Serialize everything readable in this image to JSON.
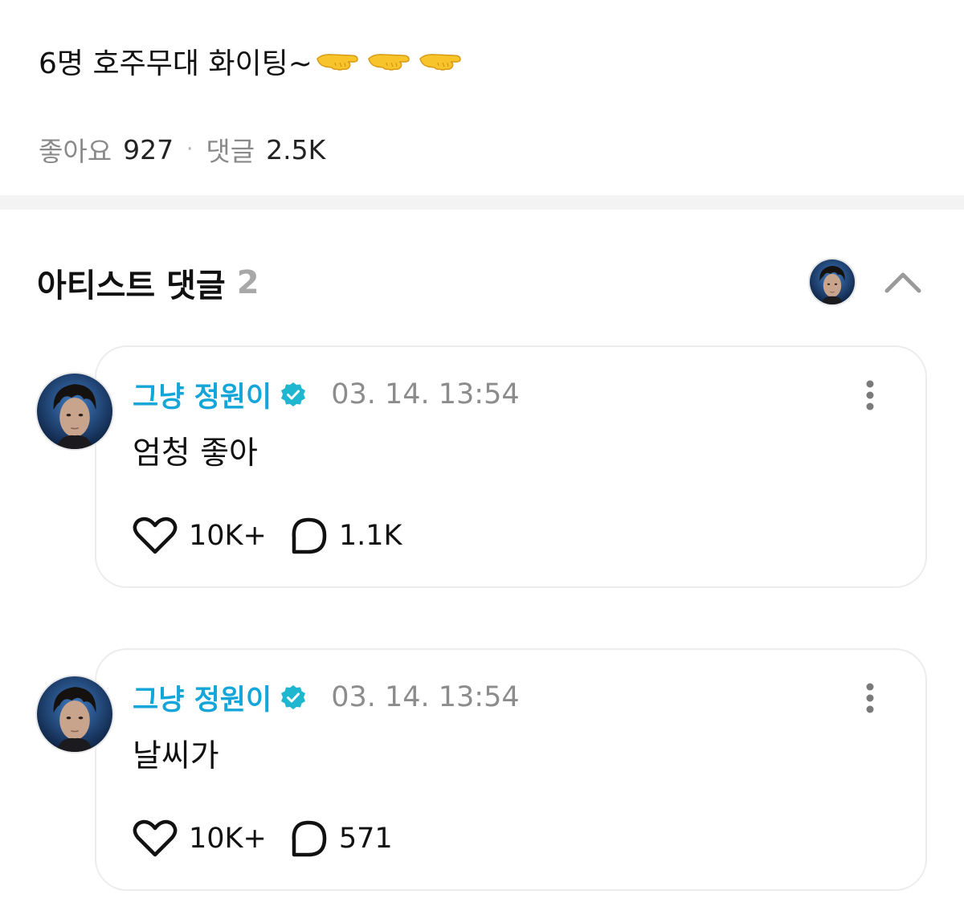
{
  "post": {
    "text": "6명 호주무대 화이팅~",
    "emoji_icons": [
      "backhand-index-pointing-left-emoji",
      "backhand-index-pointing-left-emoji",
      "backhand-index-pointing-left-emoji"
    ],
    "likes_label": "좋아요",
    "likes_value": "927",
    "separator": "·",
    "comments_label": "댓글",
    "comments_value": "2.5K"
  },
  "artist_comments": {
    "title": "아티스트 댓글",
    "count": "2",
    "avatar_icon": "artist-avatar",
    "collapse_icon": "chevron-up-icon"
  },
  "comments": [
    {
      "author": "그냥 정원이",
      "verified_icon": "verified-badge-icon",
      "timestamp": "03. 14. 13:54",
      "text": "엄청 좋아",
      "likes": "10K+",
      "replies": "1.1K"
    },
    {
      "author": "그냥 정원이",
      "verified_icon": "verified-badge-icon",
      "timestamp": "03. 14. 13:54",
      "text": "날씨가",
      "likes": "10K+",
      "replies": "571"
    }
  ],
  "colors": {
    "author": "#14a5d9",
    "verified": "#1fb6cf",
    "muted": "#8c8c8c",
    "divider": "#f3f3f4",
    "card_border": "#ececee"
  }
}
